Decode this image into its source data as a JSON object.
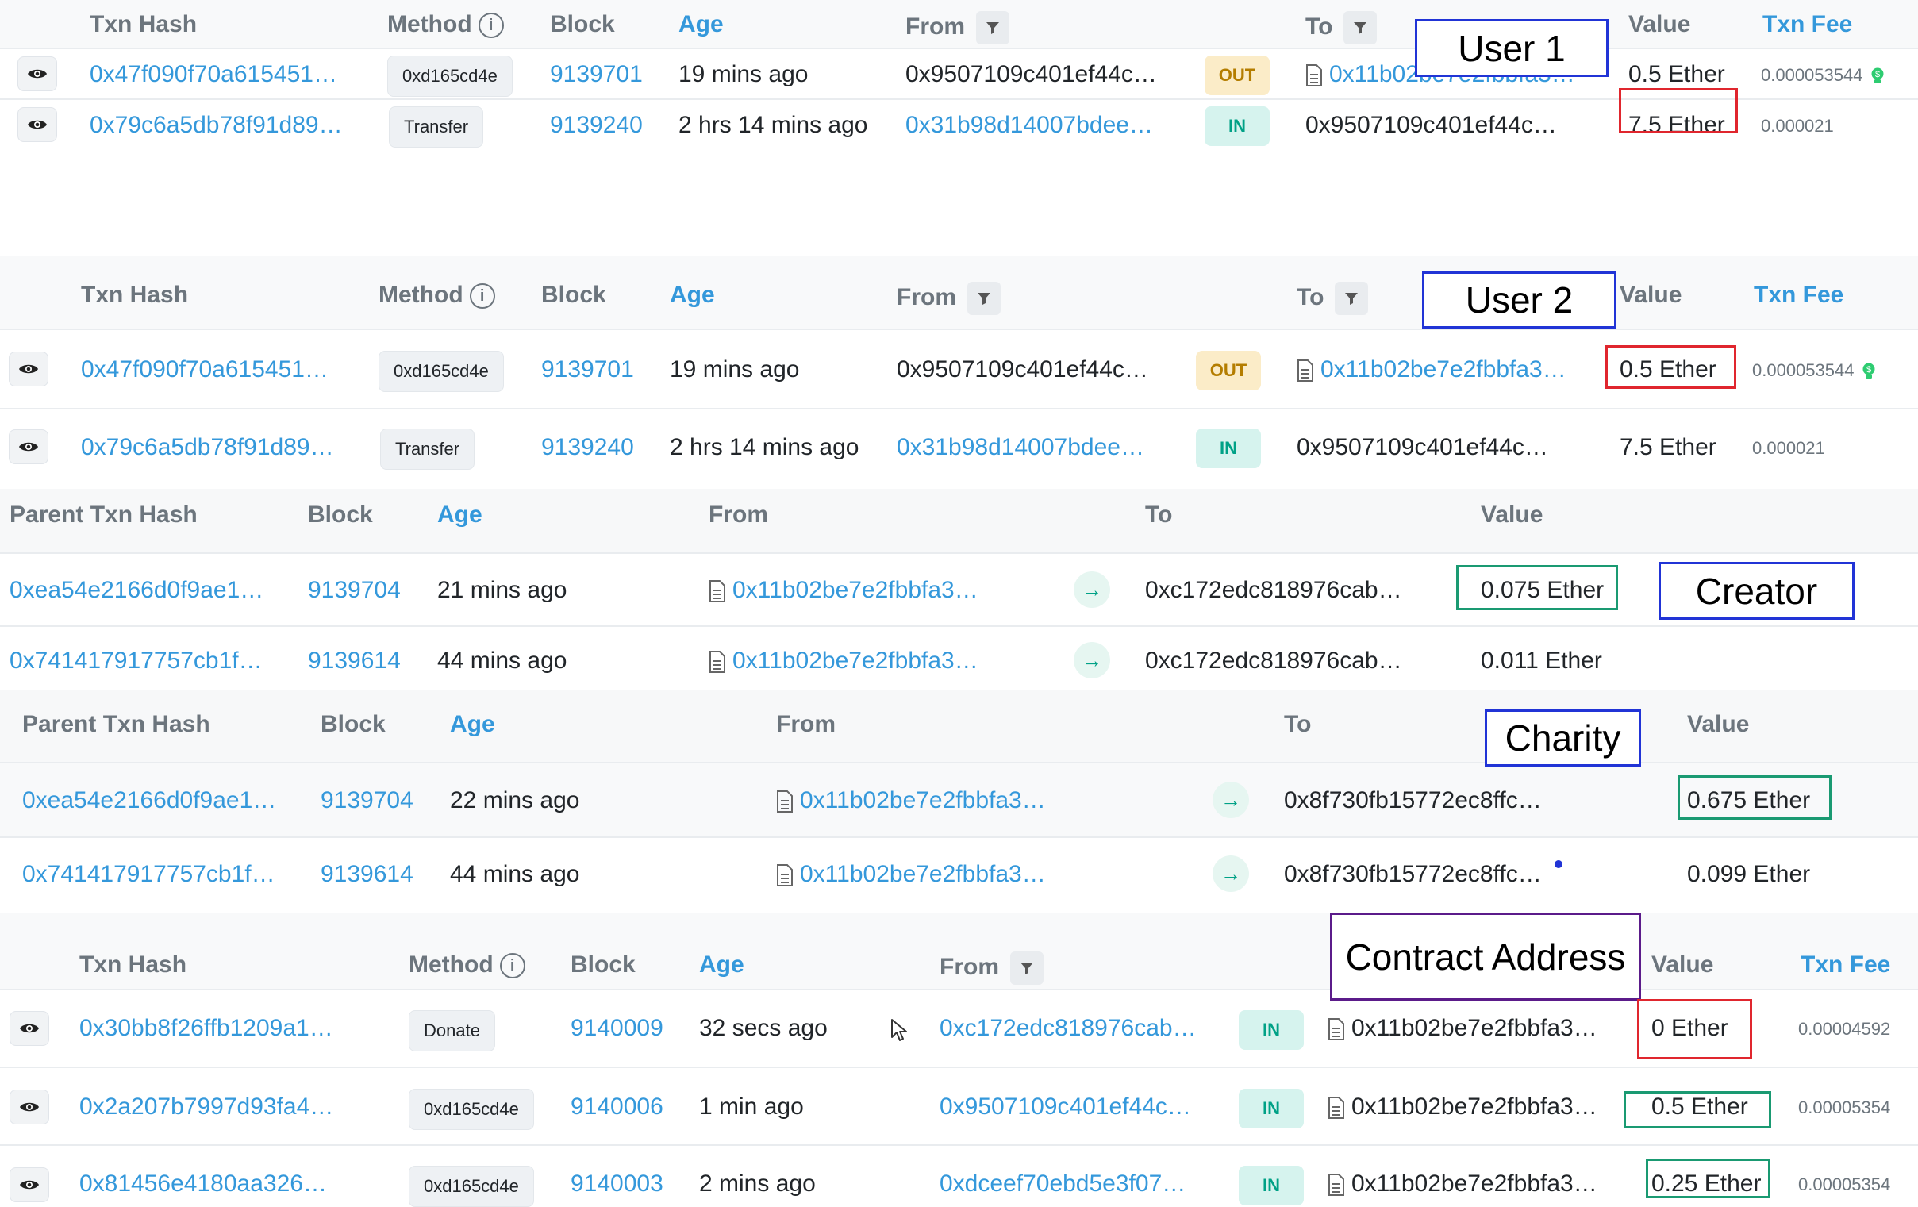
{
  "annotations": {
    "user1": "User 1",
    "user2": "User 2",
    "creator": "Creator",
    "charity": "Charity",
    "contract": "Contract Address"
  },
  "txn_columns": {
    "hash": "Txn Hash",
    "method": "Method",
    "block": "Block",
    "age": "Age",
    "from": "From",
    "to": "To",
    "value": "Value",
    "fee": "Txn Fee"
  },
  "internal_columns": {
    "hash": "Parent Txn Hash",
    "block": "Block",
    "age": "Age",
    "from": "From",
    "to": "To",
    "value": "Value"
  },
  "user1_rows": [
    {
      "hash": "0x47f090f70a615451…",
      "method": "0xd165cd4e",
      "block": "9139701",
      "age": "19 mins ago",
      "from": "0x9507109c401ef44c…",
      "dir": "OUT",
      "to": "0x11b02be7e2fbbfa3…",
      "value": "0.5 Ether",
      "fee": "0.000053544"
    },
    {
      "hash": "0x79c6a5db78f91d89…",
      "method": "Transfer",
      "block": "9139240",
      "age": "2 hrs 14 mins ago",
      "from": "0x31b98d14007bdee…",
      "dir": "IN",
      "to": "0x9507109c401ef44c…",
      "value": "7.5 Ether",
      "fee": "0.000021"
    }
  ],
  "user2_rows": [
    {
      "hash": "0x47f090f70a615451…",
      "method": "0xd165cd4e",
      "block": "9139701",
      "age": "19 mins ago",
      "from": "0x9507109c401ef44c…",
      "dir": "OUT",
      "to": "0x11b02be7e2fbbfa3…",
      "value": "0.5 Ether",
      "fee": "0.000053544"
    },
    {
      "hash": "0x79c6a5db78f91d89…",
      "method": "Transfer",
      "block": "9139240",
      "age": "2 hrs 14 mins ago",
      "from": "0x31b98d14007bdee…",
      "dir": "IN",
      "to": "0x9507109c401ef44c…",
      "value": "7.5 Ether",
      "fee": "0.000021"
    }
  ],
  "creator_rows": [
    {
      "hash": "0xea54e2166d0f9ae1…",
      "block": "9139704",
      "age": "21 mins ago",
      "from": "0x11b02be7e2fbbfa3…",
      "to": "0xc172edc818976cab…",
      "value": "0.075 Ether"
    },
    {
      "hash": "0x741417917757cb1f…",
      "block": "9139614",
      "age": "44 mins ago",
      "from": "0x11b02be7e2fbbfa3…",
      "to": "0xc172edc818976cab…",
      "value": "0.011 Ether"
    }
  ],
  "charity_rows": [
    {
      "hash": "0xea54e2166d0f9ae1…",
      "block": "9139704",
      "age": "22 mins ago",
      "from": "0x11b02be7e2fbbfa3…",
      "to": "0x8f730fb15772ec8ffc…",
      "value": "0.675 Ether"
    },
    {
      "hash": "0x741417917757cb1f…",
      "block": "9139614",
      "age": "44 mins ago",
      "from": "0x11b02be7e2fbbfa3…",
      "to": "0x8f730fb15772ec8ffc…",
      "value": "0.099 Ether"
    }
  ],
  "contract_rows": [
    {
      "hash": "0x30bb8f26ffb1209a1…",
      "method": "Donate",
      "block": "9140009",
      "age": "32 secs ago",
      "from": "0xc172edc818976cab…",
      "dir": "IN",
      "to": "0x11b02be7e2fbbfa3…",
      "value": "0 Ether",
      "fee": "0.00004592"
    },
    {
      "hash": "0x2a207b7997d93fa4…",
      "method": "0xd165cd4e",
      "block": "9140006",
      "age": "1 min ago",
      "from": "0x9507109c401ef44c…",
      "dir": "IN",
      "to": "0x11b02be7e2fbbfa3…",
      "value": "0.5 Ether",
      "fee": "0.00005354"
    },
    {
      "hash": "0x81456e4180aa326…",
      "method": "0xd165cd4e",
      "block": "9140003",
      "age": "2 mins ago",
      "from": "0xdceef70ebd5e3f07…",
      "dir": "IN",
      "to": "0x11b02be7e2fbbfa3…",
      "value": "0.25 Ether",
      "fee": "0.00005354"
    }
  ],
  "colors": {
    "link": "#3498db",
    "out_badge": "#fbecc8",
    "in_badge": "#d6f3ee",
    "highlight_red": "#e0262e",
    "highlight_green": "#1a9a72",
    "label_blue": "#2134d6",
    "label_purple": "#5b1b8a"
  },
  "icons": [
    "eye-icon",
    "filter-icon",
    "info-icon",
    "document-icon",
    "arrow-right-icon",
    "gas-bulb-icon",
    "mouse-cursor-icon"
  ]
}
